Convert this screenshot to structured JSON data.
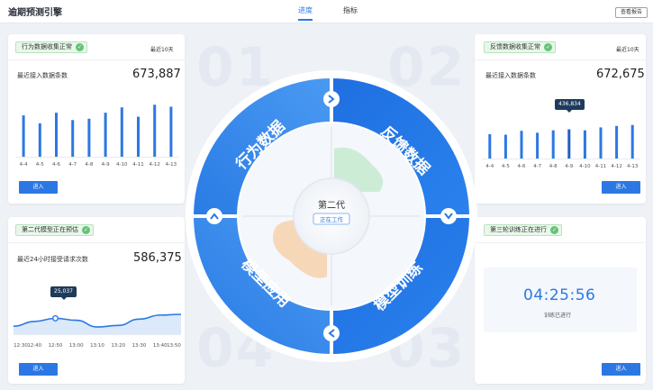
{
  "app": {
    "title": "逾期预测引擎",
    "report_button": "查看报告"
  },
  "tabs": [
    {
      "label": "进度",
      "active": true
    },
    {
      "label": "指标",
      "active": false
    }
  ],
  "background_numbers": [
    "01",
    "02",
    "03",
    "04"
  ],
  "colors": {
    "accent": "#2b78e4",
    "badge_bg": "#e9f7ea",
    "check": "#66c27a"
  },
  "cards": {
    "behavior": {
      "badge": "行为数据收集正常",
      "range": "最近10天",
      "metric_label": "最近接入数据条数",
      "metric_value": "673,887",
      "button": "进入",
      "chart_data": {
        "type": "bar",
        "categories": [
          "4-4",
          "4-5",
          "4-6",
          "4-7",
          "4-8",
          "4-9",
          "4-10",
          "4-11",
          "4-12",
          "4-13"
        ],
        "values": [
          62,
          50,
          66,
          55,
          57,
          66,
          74,
          60,
          78,
          75
        ],
        "ylim": [
          0,
          100
        ],
        "grid": false
      }
    },
    "feedback": {
      "badge": "反馈数据收集正常",
      "range": "最近10天",
      "metric_label": "最近接入数据条数",
      "metric_value": "672,675",
      "button": "进入",
      "tooltip": "436,834",
      "chart_data": {
        "type": "bar",
        "categories": [
          "4-4",
          "4-5",
          "4-6",
          "4-7",
          "4-8",
          "4-9",
          "4-10",
          "4-11",
          "4-12",
          "4-13"
        ],
        "values": [
          50,
          49,
          57,
          53,
          58,
          60,
          58,
          64,
          67,
          69
        ],
        "ylim": [
          0,
          100
        ],
        "grid": false,
        "highlight_index": 5
      }
    },
    "model": {
      "badge": "第二代模型正在预估",
      "metric_label": "最近24小时接受请求次数",
      "metric_value": "586,375",
      "button": "进入",
      "tooltip": "25,037",
      "chart_data": {
        "type": "area",
        "x": [
          "12:30",
          "12:40",
          "12:50",
          "13:00",
          "13:10",
          "13:20",
          "13:30",
          "13:40",
          "13:50"
        ],
        "values": [
          20,
          32,
          40,
          35,
          18,
          22,
          38,
          48,
          50
        ],
        "ylim": [
          0,
          100
        ],
        "grid": false,
        "highlight_index": 2
      }
    },
    "training": {
      "badge": "第三轮训练正在进行",
      "timer": "04:25:56",
      "timer_label": "训练已进行",
      "button": "进入"
    }
  },
  "wheel": {
    "segments": [
      "行为数据",
      "反馈数据",
      "模型训练",
      "模型应用"
    ],
    "center_title": "第二代",
    "center_status": "正在工作",
    "arrow_icons": [
      "chevron-right-icon",
      "chevron-down-icon",
      "chevron-left-icon",
      "chevron-up-icon"
    ]
  }
}
